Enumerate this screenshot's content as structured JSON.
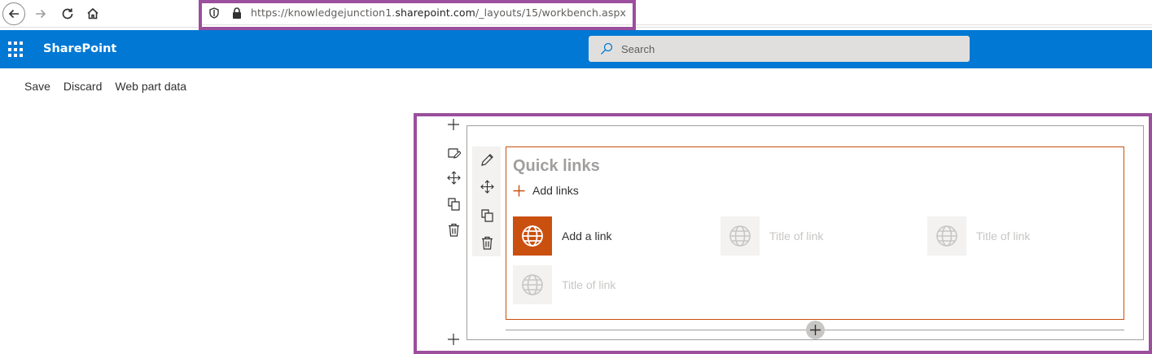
{
  "browser": {
    "url_prefix": "https://knowledgejunction1.",
    "url_domain": "sharepoint.com",
    "url_path": "/_layouts/15/workbench.aspx"
  },
  "suite_bar": {
    "brand": "SharePoint",
    "search_placeholder": "Search",
    "color": "#0078d4"
  },
  "command_bar": {
    "save": "Save",
    "discard": "Discard",
    "webpart_data": "Web part data"
  },
  "section_toolbar": [
    "edit-section-icon",
    "move-icon",
    "duplicate-icon",
    "delete-icon"
  ],
  "webpart_toolbar": [
    "edit-webpart-icon",
    "move-icon",
    "duplicate-icon",
    "delete-icon"
  ],
  "quick_links": {
    "title": "Quick links",
    "add_links_label": "Add links",
    "accent": "#ca5010",
    "links": [
      {
        "label": "Add a link",
        "icon": "globe-icon",
        "placeholder": false
      },
      {
        "label": "Title of link",
        "icon": "globe-icon",
        "placeholder": true
      },
      {
        "label": "Title of link",
        "icon": "globe-icon",
        "placeholder": true
      },
      {
        "label": "Title of link",
        "icon": "globe-icon",
        "placeholder": true
      }
    ]
  },
  "highlight_color": "#9b4f9d"
}
